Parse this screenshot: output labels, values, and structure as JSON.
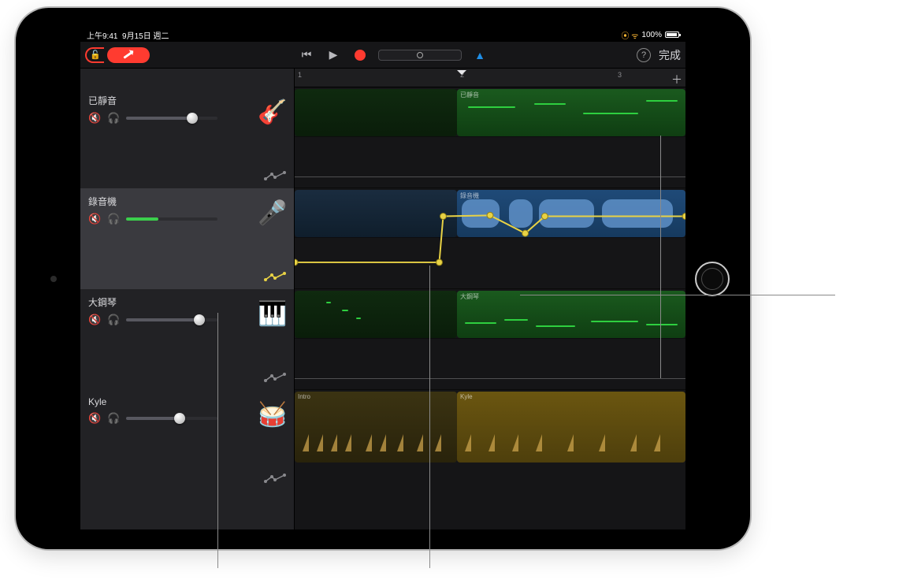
{
  "status": {
    "time": "上午9:41",
    "date": "9月15日 週二",
    "battery_percent": "100%"
  },
  "toolbar": {
    "done_label": "完成"
  },
  "ruler": {
    "ticks": [
      "1",
      "2",
      "3"
    ]
  },
  "tracks": [
    {
      "name": "已靜音",
      "instrument": "bass",
      "volume_pct": 72,
      "level_color": "gray",
      "selected": false,
      "auto_active": false
    },
    {
      "name": "錄音機",
      "instrument": "microphone",
      "volume_pct": 35,
      "level_color": "green",
      "selected": true,
      "auto_active": true
    },
    {
      "name": "大鋼琴",
      "instrument": "piano",
      "volume_pct": 80,
      "level_color": "gray",
      "selected": false,
      "auto_active": false
    },
    {
      "name": "Kyle",
      "instrument": "drums",
      "volume_pct": 58,
      "level_color": "gray",
      "selected": false,
      "auto_active": false
    }
  ],
  "regions": {
    "lane1": {
      "dim_label": "",
      "bright_label": "已靜音"
    },
    "lane2": {
      "dim_label": "",
      "bright_label": "錄音機"
    },
    "lane3": {
      "dim_label": "",
      "bright_label": "大鋼琴"
    },
    "lane4": {
      "dim_label": "Intro",
      "bright_label": "Kyle"
    }
  },
  "chart_data": {
    "type": "line",
    "note": "Volume automation curve on 錄音機 track; x is normalized timeline position 0..1, y is 0 (lane bottom)..1 (lane top)",
    "series": [
      {
        "name": "錄音機 volume automation",
        "points": [
          {
            "x": 0.0,
            "y": 0.26
          },
          {
            "x": 0.37,
            "y": 0.26
          },
          {
            "x": 0.38,
            "y": 0.72
          },
          {
            "x": 0.5,
            "y": 0.73
          },
          {
            "x": 0.59,
            "y": 0.55
          },
          {
            "x": 0.64,
            "y": 0.72
          },
          {
            "x": 1.0,
            "y": 0.72
          }
        ]
      }
    ],
    "xlim": [
      0,
      1
    ],
    "ylim": [
      0,
      1
    ]
  }
}
